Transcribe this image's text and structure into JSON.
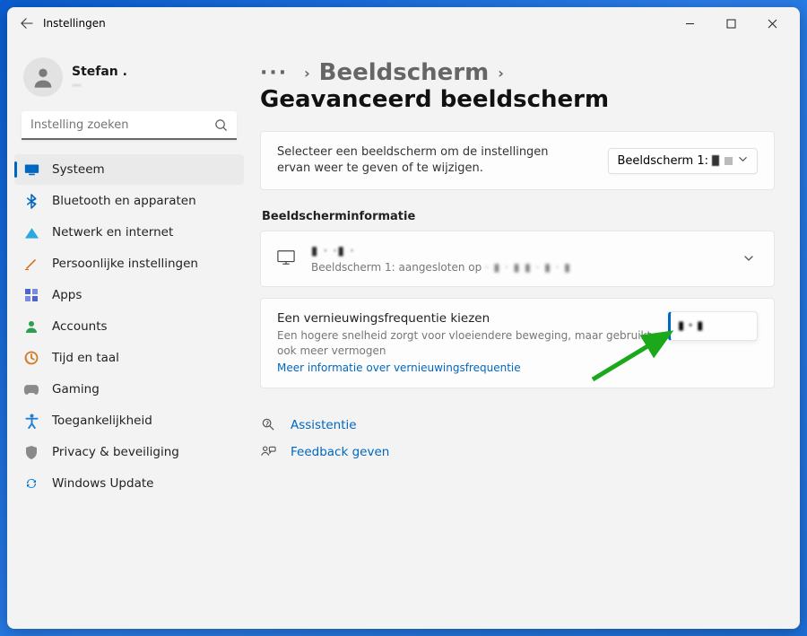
{
  "titlebar": {
    "title": "Instellingen"
  },
  "profile": {
    "name": "Stefan .",
    "sub": "—"
  },
  "search": {
    "placeholder": "Instelling zoeken"
  },
  "sidebar": {
    "items": [
      {
        "label": "Systeem",
        "icon": "system",
        "color": "#0067c0",
        "active": true
      },
      {
        "label": "Bluetooth en apparaten",
        "icon": "bluetooth",
        "color": "#0067c0",
        "active": false
      },
      {
        "label": "Netwerk en internet",
        "icon": "network",
        "color": "#2aa8e0",
        "active": false
      },
      {
        "label": "Persoonlijke instellingen",
        "icon": "personal",
        "color": "#d06600",
        "active": false
      },
      {
        "label": "Apps",
        "icon": "apps",
        "color": "#5064c8",
        "active": false
      },
      {
        "label": "Accounts",
        "icon": "accounts",
        "color": "#2e9e4f",
        "active": false
      },
      {
        "label": "Tijd en taal",
        "icon": "time",
        "color": "#d07a2a",
        "active": false
      },
      {
        "label": "Gaming",
        "icon": "gaming",
        "color": "#8a8a8a",
        "active": false
      },
      {
        "label": "Toegankelijkheid",
        "icon": "access",
        "color": "#1c7ed6",
        "active": false
      },
      {
        "label": "Privacy & beveiliging",
        "icon": "privacy",
        "color": "#8a8a8a",
        "active": false
      },
      {
        "label": "Windows Update",
        "icon": "update",
        "color": "#0078d4",
        "active": false
      }
    ]
  },
  "breadcrumb": {
    "prev": "Beeldscherm",
    "current": "Geavanceerd beeldscherm"
  },
  "intro": {
    "text": "Selecteer een beeldscherm om de instellingen ervan weer te geven of te wijzigen.",
    "select_label": "Beeldscherm 1:"
  },
  "section": {
    "info_title": "Beeldscherminformatie"
  },
  "info": {
    "title": "▮ · ·▮ ·",
    "sub_prefix": "Beeldscherm 1: aangesloten op",
    "sub_blur": "· ▮  · ▮ ▮ · ▮ · ▮"
  },
  "refresh": {
    "title": "Een vernieuwingsfrequentie kiezen",
    "desc": "Een hogere snelheid zorgt voor vloeiendere beweging, maar gebruikt ook meer vermogen",
    "link": "Meer informatie over vernieuwingsfrequentie",
    "value": "▮ · ▮"
  },
  "links": {
    "assist": "Assistentie",
    "feedback": "Feedback geven"
  }
}
